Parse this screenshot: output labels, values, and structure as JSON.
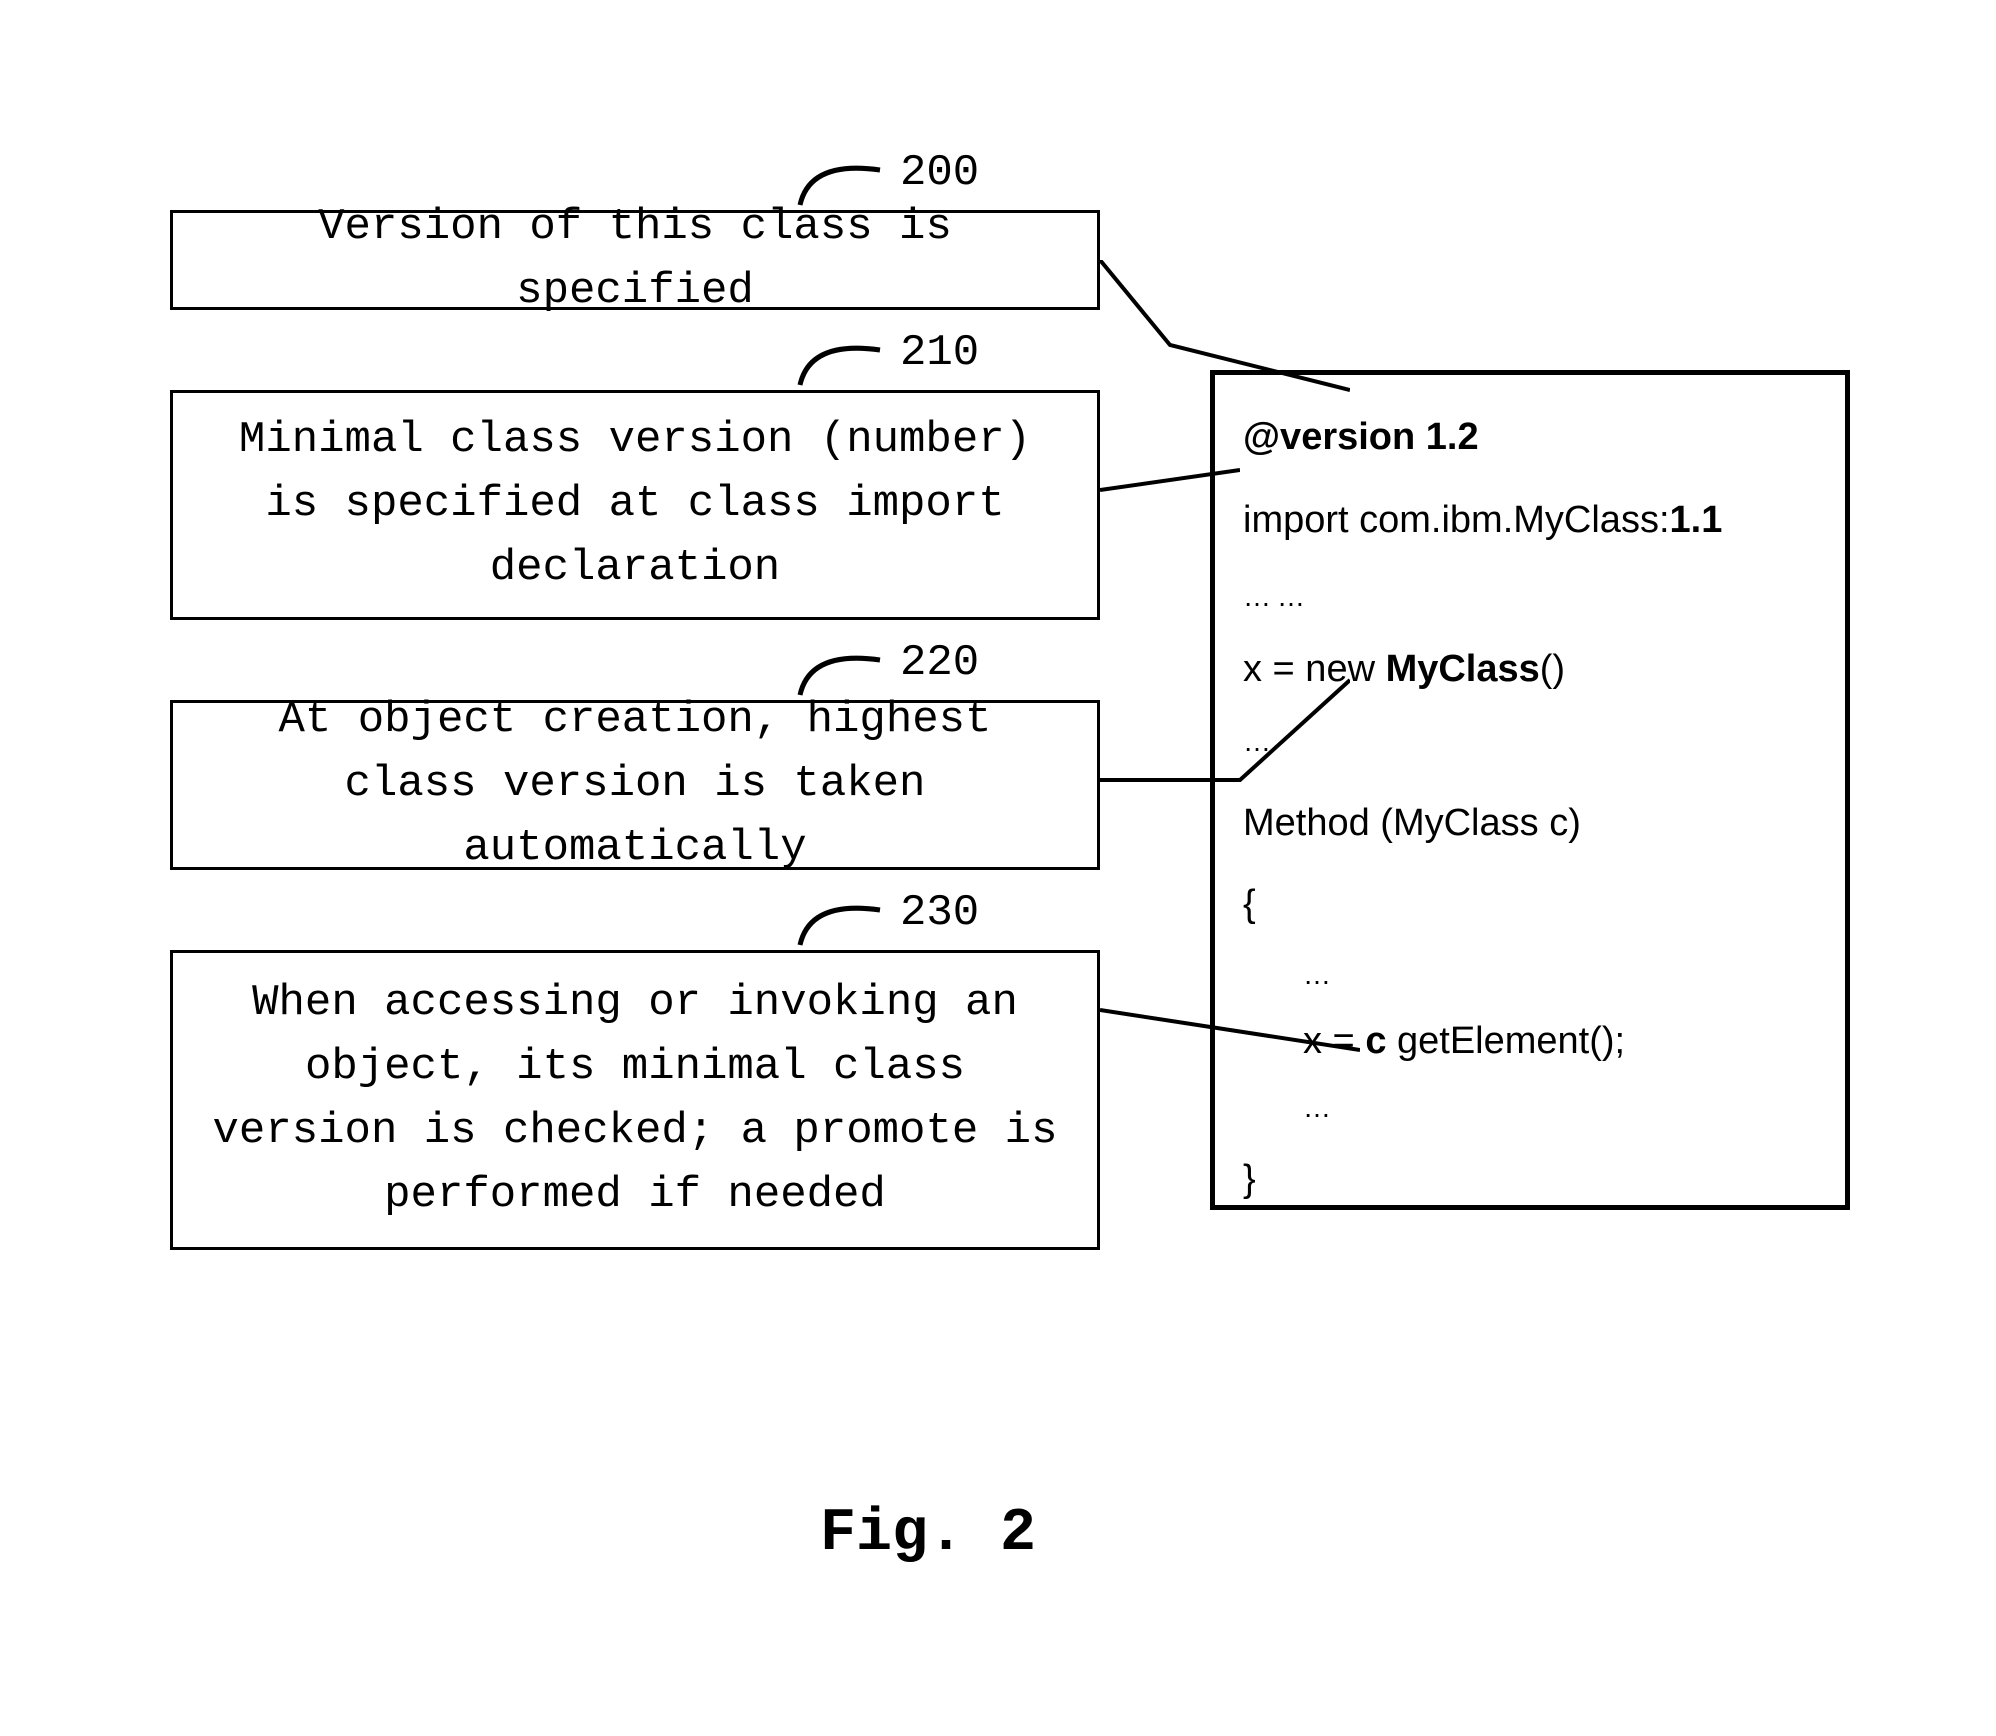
{
  "figure_label": "Fig. 2",
  "steps": [
    {
      "ref": "200",
      "text": "Version of this class is specified"
    },
    {
      "ref": "210",
      "text": "Minimal class version (number) is specified at class import declaration"
    },
    {
      "ref": "220",
      "text": "At object creation, highest class version is taken automatically"
    },
    {
      "ref": "230",
      "text": "When accessing or invoking an object, its minimal class version is checked; a promote is performed if needed"
    }
  ],
  "code": {
    "version_line_prefix": "@version ",
    "version_value": "1.2",
    "import_line_prefix": "import com.ibm.MyClass:",
    "import_version": "1.1",
    "ellipsis1": "……",
    "new_line_prefix": "x = new ",
    "new_class": "MyClass",
    "new_line_suffix": "()",
    "ellipsis2": "…",
    "method_decl": "Method (MyClass c)",
    "open_brace": "{",
    "ellipsis3": "…",
    "get_prefix": "x = ",
    "get_obj": "c",
    "get_suffix": " getElement();",
    "ellipsis4": "…",
    "close_brace": "}"
  }
}
